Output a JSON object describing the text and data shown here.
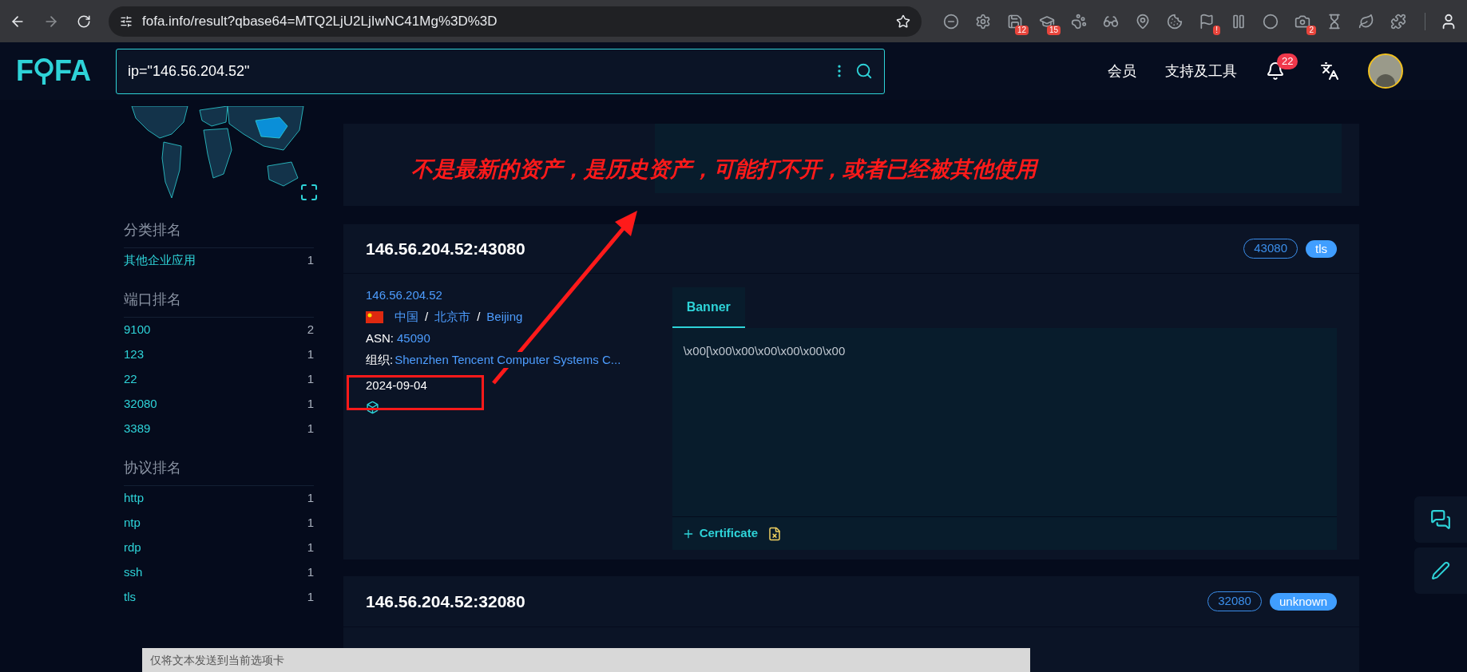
{
  "browser": {
    "url": "fofa.info/result?qbase64=MTQ2LjU2LjIwNC41Mg%3D%3D",
    "extensions": [
      {
        "kind": "minus"
      },
      {
        "kind": "gear"
      },
      {
        "kind": "save",
        "badge": "12"
      },
      {
        "kind": "hat",
        "badge": "15"
      },
      {
        "kind": "paw"
      },
      {
        "kind": "glasses"
      },
      {
        "kind": "pin"
      },
      {
        "kind": "cookie"
      },
      {
        "kind": "flag",
        "badge": "!"
      },
      {
        "kind": "bars"
      },
      {
        "kind": "ring"
      },
      {
        "kind": "camera",
        "badge": "2"
      },
      {
        "kind": "hourglass"
      },
      {
        "kind": "leaf"
      },
      {
        "kind": "puzzle"
      }
    ]
  },
  "header": {
    "logo_left": "F",
    "logo_right": "FA",
    "search": {
      "value": "ip=\"146.56.204.52\""
    },
    "nav": [
      "会员",
      "支持及工具"
    ],
    "notifications": "22"
  },
  "sidebar": {
    "sections": [
      {
        "title": "分类排名",
        "items": [
          {
            "label": "其他企业应用",
            "count": "1"
          }
        ]
      },
      {
        "title": "端口排名",
        "items": [
          {
            "label": "9100",
            "count": "2"
          },
          {
            "label": "123",
            "count": "1"
          },
          {
            "label": "22",
            "count": "1"
          },
          {
            "label": "32080",
            "count": "1"
          },
          {
            "label": "3389",
            "count": "1"
          }
        ]
      },
      {
        "title": "协议排名",
        "items": [
          {
            "label": "http",
            "count": "1"
          },
          {
            "label": "ntp",
            "count": "1"
          },
          {
            "label": "rdp",
            "count": "1"
          },
          {
            "label": "ssh",
            "count": "1"
          },
          {
            "label": "tls",
            "count": "1"
          }
        ]
      }
    ]
  },
  "results": [
    {
      "title": "146.56.204.52:43080",
      "port": "43080",
      "protocol": "tls",
      "ip": "146.56.204.52",
      "country": "中国",
      "region": "北京市",
      "city": "Beijing",
      "separator": "/",
      "asn_label": "ASN:",
      "asn": "45090",
      "org_label": "组织:",
      "org": "Shenzhen Tencent Computer Systems C...",
      "date": "2024-09-04",
      "tabs": [
        {
          "label": "Banner",
          "selected": true
        }
      ],
      "banner": "\\x00[\\x00\\x00\\x00\\x00\\x00\\x00",
      "certificate": "Certificate"
    },
    {
      "title": "146.56.204.52:32080",
      "port": "32080",
      "protocol": "unknown"
    }
  ],
  "annotation": {
    "text": "不是最新的资产，是历史资产，可能打不开，或者已经被其他使用"
  },
  "popup": {
    "text": "仅将文本发送到当前选项卡"
  }
}
